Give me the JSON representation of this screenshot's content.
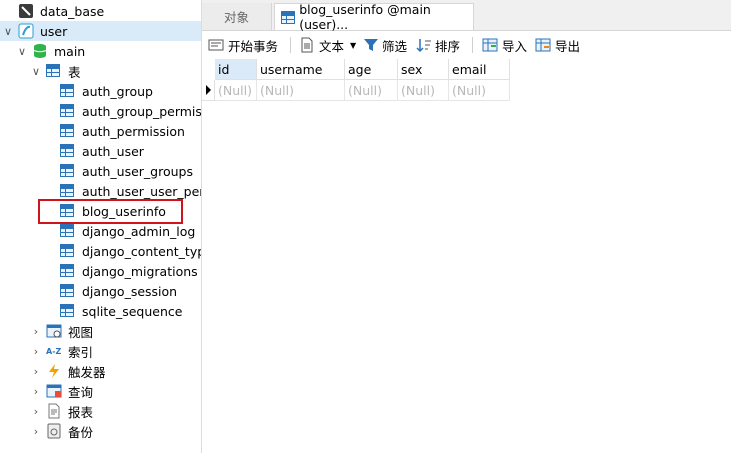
{
  "sidebar": {
    "root_connection": "data_base",
    "user_connection": "user",
    "database": "main",
    "tables_group": "表",
    "tables": [
      "auth_group",
      "auth_group_permiss",
      "auth_permission",
      "auth_user",
      "auth_user_groups",
      "auth_user_user_perm",
      "blog_userinfo",
      "django_admin_log",
      "django_content_type",
      "django_migrations",
      "django_session",
      "sqlite_sequence"
    ],
    "groups": [
      {
        "label": "视图",
        "icon": "view-icon"
      },
      {
        "label": "索引",
        "icon": "index-icon"
      },
      {
        "label": "触发器",
        "icon": "trigger-icon"
      },
      {
        "label": "查询",
        "icon": "query-icon"
      },
      {
        "label": "报表",
        "icon": "report-icon"
      },
      {
        "label": "备份",
        "icon": "backup-icon"
      }
    ],
    "highlighted_table": "blog_userinfo"
  },
  "tabs": {
    "objects": "对象",
    "active": "blog_userinfo @main (user)..."
  },
  "toolbar": {
    "begin_transaction": "开始事务",
    "text": "文本",
    "filter": "筛选",
    "sort": "排序",
    "import": "导入",
    "export": "导出"
  },
  "grid": {
    "columns": [
      "id",
      "username",
      "age",
      "sex",
      "email"
    ],
    "rows": [
      [
        "(Null)",
        "(Null)",
        "(Null)",
        "(Null)",
        "(Null)"
      ]
    ]
  },
  "colors": {
    "accent": "#2a73b8",
    "selection": "#d9ebf9",
    "highlight_border": "#d0141b"
  }
}
